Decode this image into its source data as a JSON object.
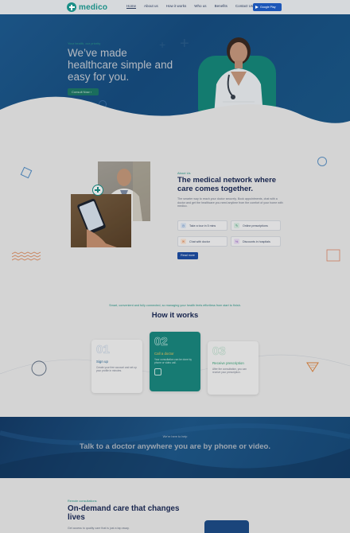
{
  "brand": {
    "name": "medico",
    "accent": "#1b8f87",
    "navy": "#1b2a57",
    "blue": "#1d4fa5"
  },
  "nav": {
    "links": [
      "Home",
      "About us",
      "How it works",
      "Who us",
      "Benefits",
      "Contact Us"
    ],
    "store_button": "Google Play"
  },
  "hero": {
    "eyebrow": "Your health, our priority",
    "title": "We’ve made healthcare simple and easy for you.",
    "cta": "Consult Now"
  },
  "about": {
    "eyebrow": "About Us",
    "title": "The medical network where care comes together.",
    "description": "The smarter way to reach your doctor securely. Book appointments, chat with a doctor and get the healthcare you need anytime from the comfort of your home with medico.",
    "features": [
      {
        "label": "Take a tour in 5 mins",
        "icon": "clock-icon"
      },
      {
        "label": "Online prescriptions",
        "icon": "prescription-icon"
      },
      {
        "label": "Chat with doctor",
        "icon": "chat-icon"
      },
      {
        "label": "Discounts in hospitals",
        "icon": "discount-icon"
      }
    ],
    "cta": "Read more"
  },
  "how": {
    "eyebrow": "Smart, convenient and fully connected, so managing your health feels effortless from start to finish.",
    "title": "How it works",
    "steps": [
      {
        "number": "01",
        "title": "Sign up",
        "description": "Create your free account and set up your profile in minutes."
      },
      {
        "number": "02",
        "title": "Call a doctor",
        "description": "Your consultation can be done by phone or video call."
      },
      {
        "number": "03",
        "title": "Receive prescription",
        "description": "After the consultation, you can receive your prescription."
      }
    ]
  },
  "banner": {
    "eyebrow": "We're here to help",
    "title": "Talk to a doctor anywhere you are by phone or video."
  },
  "ondemand": {
    "eyebrow": "Remote consultations",
    "title": "On-demand care that changes lives",
    "description": "Get access to quality care that is just a tap away."
  }
}
